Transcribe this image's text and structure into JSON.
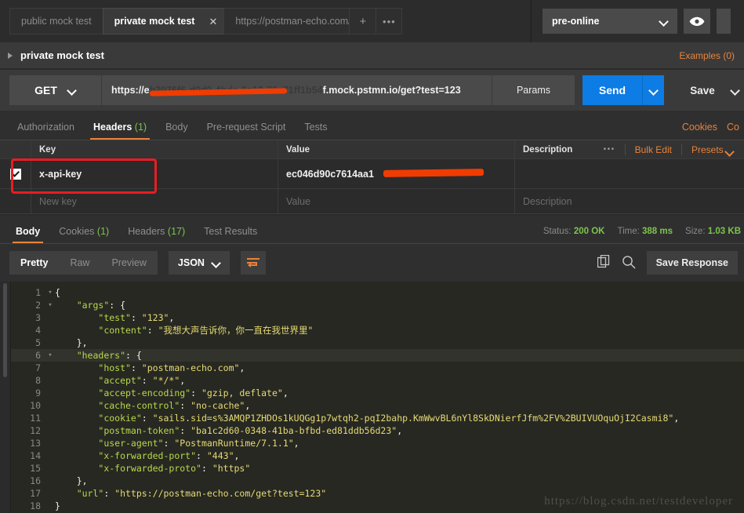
{
  "tabbar": {
    "tabs": [
      {
        "label": "public mock test",
        "active": false
      },
      {
        "label": "private mock test",
        "active": true
      },
      {
        "label": "https://postman-echo.com/",
        "active": false
      }
    ],
    "close_icon": "✕",
    "new_tab_label": "+",
    "more_label": "•••",
    "environment": "pre-online",
    "eye_icon": "eye-icon"
  },
  "request": {
    "name": "private mock test",
    "examples_label": "Examples (0)",
    "method": "GET",
    "url_prefix": "https://e",
    "url_suffix": "f.mock.pstmn.io/get?test=123",
    "url_full": "https://e████████f.mock.pstmn.io/get?test=123",
    "params_label": "Params",
    "send_label": "Send",
    "save_label": "Save",
    "tabs": [
      {
        "label": "Authorization",
        "count": "",
        "active": false
      },
      {
        "label": "Headers",
        "count": "(1)",
        "active": true
      },
      {
        "label": "Body",
        "count": "",
        "active": false
      },
      {
        "label": "Pre-request Script",
        "count": "",
        "active": false
      },
      {
        "label": "Tests",
        "count": "",
        "active": false
      }
    ],
    "right_links": [
      "Cookies",
      "Co"
    ]
  },
  "headers_table": {
    "columns": [
      "Key",
      "Value",
      "Description"
    ],
    "tools": {
      "dots": "•••",
      "bulk_edit": "Bulk Edit",
      "presets": "Presets"
    },
    "rows": [
      {
        "checked": true,
        "key": "x-api-key",
        "value": "ec046d90c7614aa1",
        "description": ""
      }
    ],
    "empty_row": {
      "key_placeholder": "New key",
      "value_placeholder": "Value",
      "desc_placeholder": "Description"
    }
  },
  "response": {
    "tabs": [
      {
        "label": "Body",
        "count": "",
        "active": true
      },
      {
        "label": "Cookies",
        "count": "(1)",
        "active": false
      },
      {
        "label": "Headers",
        "count": "(17)",
        "active": false
      },
      {
        "label": "Test Results",
        "count": "",
        "active": false
      }
    ],
    "status_label": "Status:",
    "status_value": "200 OK",
    "time_label": "Time:",
    "time_value": "388 ms",
    "size_label": "Size:",
    "size_value": "1.03 KB",
    "view_modes": [
      {
        "label": "Pretty",
        "active": true
      },
      {
        "label": "Raw",
        "active": false
      },
      {
        "label": "Preview",
        "active": false
      }
    ],
    "format": "JSON",
    "wrap_icon": "word-wrap-icon",
    "copy_icon": "copy-icon",
    "search_icon": "search-icon",
    "save_response_label": "Save Response"
  },
  "code": {
    "lines": [
      {
        "n": "1",
        "fold": "▾",
        "indent": 0,
        "text": "{",
        "hl": false
      },
      {
        "n": "2",
        "fold": "▾",
        "indent": 1,
        "text": "\"args\": {",
        "hl": false
      },
      {
        "n": "3",
        "fold": "",
        "indent": 2,
        "text": "\"test\": \"123\",",
        "hl": false
      },
      {
        "n": "4",
        "fold": "",
        "indent": 2,
        "text": "\"content\": \"我想大声告诉你，你一直在我世界里\"",
        "hl": false
      },
      {
        "n": "5",
        "fold": "",
        "indent": 1,
        "text": "},",
        "hl": false
      },
      {
        "n": "6",
        "fold": "▾",
        "indent": 1,
        "text": "\"headers\": {",
        "hl": true
      },
      {
        "n": "7",
        "fold": "",
        "indent": 2,
        "text": "\"host\": \"postman-echo.com\",",
        "hl": false
      },
      {
        "n": "8",
        "fold": "",
        "indent": 2,
        "text": "\"accept\": \"*/*\",",
        "hl": false
      },
      {
        "n": "9",
        "fold": "",
        "indent": 2,
        "text": "\"accept-encoding\": \"gzip, deflate\",",
        "hl": false
      },
      {
        "n": "10",
        "fold": "",
        "indent": 2,
        "text": "\"cache-control\": \"no-cache\",",
        "hl": false
      },
      {
        "n": "11",
        "fold": "",
        "indent": 2,
        "text": "\"cookie\": \"sails.sid=s%3AMQP1ZHDOs1kUQGg1p7wtqh2-pqI2bahp.KmWwvBL6nYl8SkDNierfJfm%2FV%2BUIVUOquOjI2Casmi8\",",
        "hl": false
      },
      {
        "n": "12",
        "fold": "",
        "indent": 2,
        "text": "\"postman-token\": \"ba1c2d60-0348-41ba-bfbd-ed81ddb56d23\",",
        "hl": false
      },
      {
        "n": "13",
        "fold": "",
        "indent": 2,
        "text": "\"user-agent\": \"PostmanRuntime/7.1.1\",",
        "hl": false
      },
      {
        "n": "14",
        "fold": "",
        "indent": 2,
        "text": "\"x-forwarded-port\": \"443\",",
        "hl": false
      },
      {
        "n": "15",
        "fold": "",
        "indent": 2,
        "text": "\"x-forwarded-proto\": \"https\"",
        "hl": false
      },
      {
        "n": "16",
        "fold": "",
        "indent": 1,
        "text": "},",
        "hl": false
      },
      {
        "n": "17",
        "fold": "",
        "indent": 1,
        "text": "\"url\": \"https://postman-echo.com/get?test=123\"",
        "hl": false
      },
      {
        "n": "18",
        "fold": "",
        "indent": 0,
        "text": "}",
        "hl": false
      }
    ]
  },
  "watermark": "https://blog.csdn.net/testdeveloper"
}
